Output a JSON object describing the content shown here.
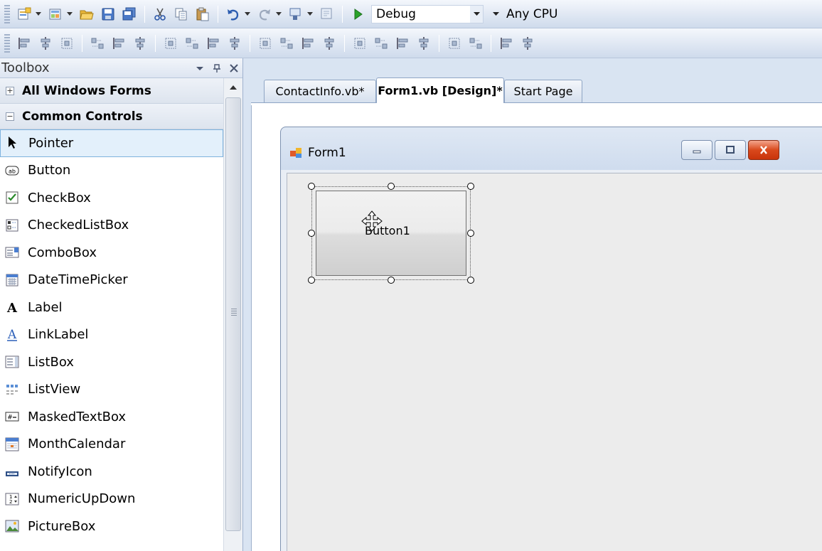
{
  "toolbar1": {
    "buttons": [
      "new-project-icon",
      "add-item-icon",
      "open-folder-icon",
      "save-icon",
      "save-all-icon",
      "cut-icon",
      "copy-icon",
      "paste-icon",
      "undo-icon",
      "redo-icon",
      "navigate-icon",
      "find-icon",
      "start-debug-icon"
    ],
    "configuration": "Debug",
    "platform": "Any CPU"
  },
  "toolbar2": {
    "layout_buttons": [
      "align-lefts-icon",
      "align-centers-icon",
      "align-rights-icon",
      "align-tops-icon",
      "align-middles-icon",
      "align-bottoms-icon",
      "make-same-width-icon",
      "make-same-height-icon",
      "size-to-grid-icon",
      "align-to-grid-icon",
      "horizontal-spacing-equal-icon",
      "increase-horizontal-spacing-icon",
      "decrease-horizontal-spacing-icon",
      "remove-horizontal-spacing-icon",
      "vertical-spacing-equal-icon",
      "increase-vertical-spacing-icon",
      "decrease-vertical-spacing-icon",
      "remove-vertical-spacing-icon",
      "center-horizontally-icon",
      "center-vertically-icon",
      "bring-to-front-icon",
      "send-to-back-icon"
    ]
  },
  "toolbox": {
    "title": "Toolbox",
    "categories": [
      {
        "label": "All Windows Forms",
        "expanded": false
      },
      {
        "label": "Common Controls",
        "expanded": true
      }
    ],
    "items": [
      {
        "label": "Pointer",
        "icon": "pointer-icon",
        "selected": true
      },
      {
        "label": "Button",
        "icon": "button-icon"
      },
      {
        "label": "CheckBox",
        "icon": "checkbox-icon"
      },
      {
        "label": "CheckedListBox",
        "icon": "checked-listbox-icon"
      },
      {
        "label": "ComboBox",
        "icon": "combobox-icon"
      },
      {
        "label": "DateTimePicker",
        "icon": "datetimepicker-icon"
      },
      {
        "label": "Label",
        "icon": "label-icon"
      },
      {
        "label": "LinkLabel",
        "icon": "linklabel-icon"
      },
      {
        "label": "ListBox",
        "icon": "listbox-icon"
      },
      {
        "label": "ListView",
        "icon": "listview-icon"
      },
      {
        "label": "MaskedTextBox",
        "icon": "maskedtextbox-icon"
      },
      {
        "label": "MonthCalendar",
        "icon": "monthcalendar-icon"
      },
      {
        "label": "NotifyIcon",
        "icon": "notifyicon-icon"
      },
      {
        "label": "NumericUpDown",
        "icon": "numericupdown-icon"
      },
      {
        "label": "PictureBox",
        "icon": "picturebox-icon"
      }
    ]
  },
  "tabs": [
    {
      "label": "ContactInfo.vb*",
      "active": false
    },
    {
      "label": "Form1.vb [Design]*",
      "active": true
    },
    {
      "label": "Start Page",
      "active": false
    }
  ],
  "designer": {
    "form_title": "Form1",
    "button_text": "Button1"
  }
}
